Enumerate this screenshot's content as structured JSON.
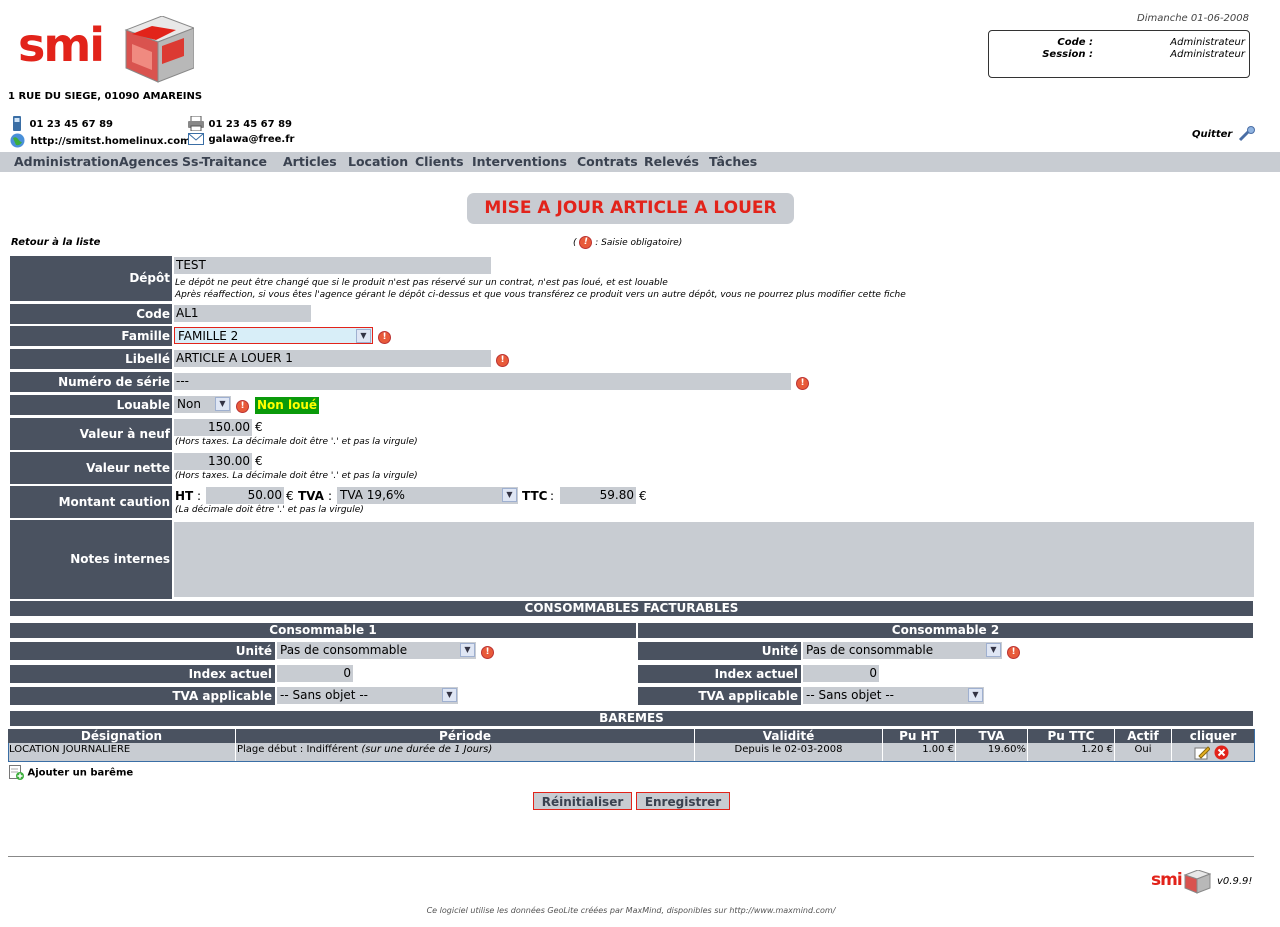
{
  "header": {
    "logo_text": "smi",
    "address": "1 RUE DU SIEGE, 01090 AMAREINS",
    "phone": "01 23 45 67 89",
    "fax": "01 23 45 67 89",
    "website": "http://smitst.homelinux.com",
    "email": "galawa@free.fr",
    "date": "Dimanche 01-06-2008",
    "code_label": "Code :",
    "code_value": "Administrateur",
    "session_label": "Session :",
    "session_value": "Administrateur",
    "quit_label": "Quitter"
  },
  "menu": [
    "Administration",
    "Agences",
    "Ss-Traitance",
    "Articles",
    "Location",
    "Clients",
    "Interventions",
    "Contrats",
    "Relevés",
    "Tâches"
  ],
  "page": {
    "title": "MISE A JOUR ARTICLE A LOUER",
    "back_link": "Retour à la liste",
    "mandatory_open": "(",
    "mandatory_text": ": Saisie obligatoire)"
  },
  "form": {
    "depot_label": "Dépôt",
    "depot_value": "TEST",
    "depot_note1": "Le dépôt ne peut être changé que si le produit n'est pas réservé sur un contrat, n'est pas loué, et est louable",
    "depot_note2": "Après réaffection, si vous êtes l'agence gérant le dépôt ci-dessus et que vous transférez ce produit vers un autre dépôt, vous ne pourrez plus modifier cette fiche",
    "code_label": "Code",
    "code_value": "AL1",
    "famille_label": "Famille",
    "famille_value": "FAMILLE 2",
    "libelle_label": "Libellé",
    "libelle_value": "ARTICLE A LOUER 1",
    "serie_label": "Numéro de série",
    "serie_value": "---",
    "louable_label": "Louable",
    "louable_value": "Non",
    "louable_status": "Non loué",
    "valeur_neuf_label": "Valeur à neuf",
    "valeur_neuf_value": "150.00",
    "valeur_nette_label": "Valeur nette",
    "valeur_nette_value": "130.00",
    "currency": "€",
    "decimal_note_ht": "(Hors taxes. La décimale doit être '.' et pas la virgule)",
    "caution_label": "Montant caution",
    "ht_label": "HT",
    "colon": ":",
    "ht_value": "50.00",
    "tva_label": "TVA",
    "tva_value": "TVA 19,6%",
    "ttc_label": "TTC",
    "ttc_value": "59.80",
    "decimal_note": "(La décimale doit être '.' et pas la virgule)",
    "notes_label": "Notes internes",
    "notes_value": ""
  },
  "consommables": {
    "section_title": "CONSOMMABLES FACTURABLES",
    "columns": [
      {
        "title": "Consommable 1",
        "unite_label": "Unité",
        "unite_value": "Pas de consommable",
        "index_label": "Index actuel",
        "index_value": "0",
        "tva_label": "TVA applicable",
        "tva_value": "-- Sans objet --"
      },
      {
        "title": "Consommable 2",
        "unite_label": "Unité",
        "unite_value": "Pas de consommable",
        "index_label": "Index actuel",
        "index_value": "0",
        "tva_label": "TVA applicable",
        "tva_value": "-- Sans objet --"
      }
    ]
  },
  "baremes": {
    "section_title": "BAREMES",
    "headers": [
      "Désignation",
      "Période",
      "Validité",
      "Pu HT",
      "TVA",
      "Pu TTC",
      "Actif",
      "cliquer"
    ],
    "rows": [
      {
        "designation": "LOCATION JOURNALIERE",
        "periode": "Plage début : Indifférent",
        "periode_note": "(sur une durée de 1 Jours)",
        "validite": "Depuis le 02-03-2008",
        "pu_ht": "1.00 €",
        "tva": "19.60%",
        "pu_ttc": "1.20 €",
        "actif": "Oui"
      }
    ],
    "add_label": "Ajouter un barême"
  },
  "buttons": {
    "reset": "Réinitialiser",
    "save": "Enregistrer"
  },
  "footer": {
    "version": "v0.9.9!",
    "credit": "Ce logiciel utilise les données GeoLite créées par MaxMind, disponibles sur http://www.maxmind.com/"
  }
}
